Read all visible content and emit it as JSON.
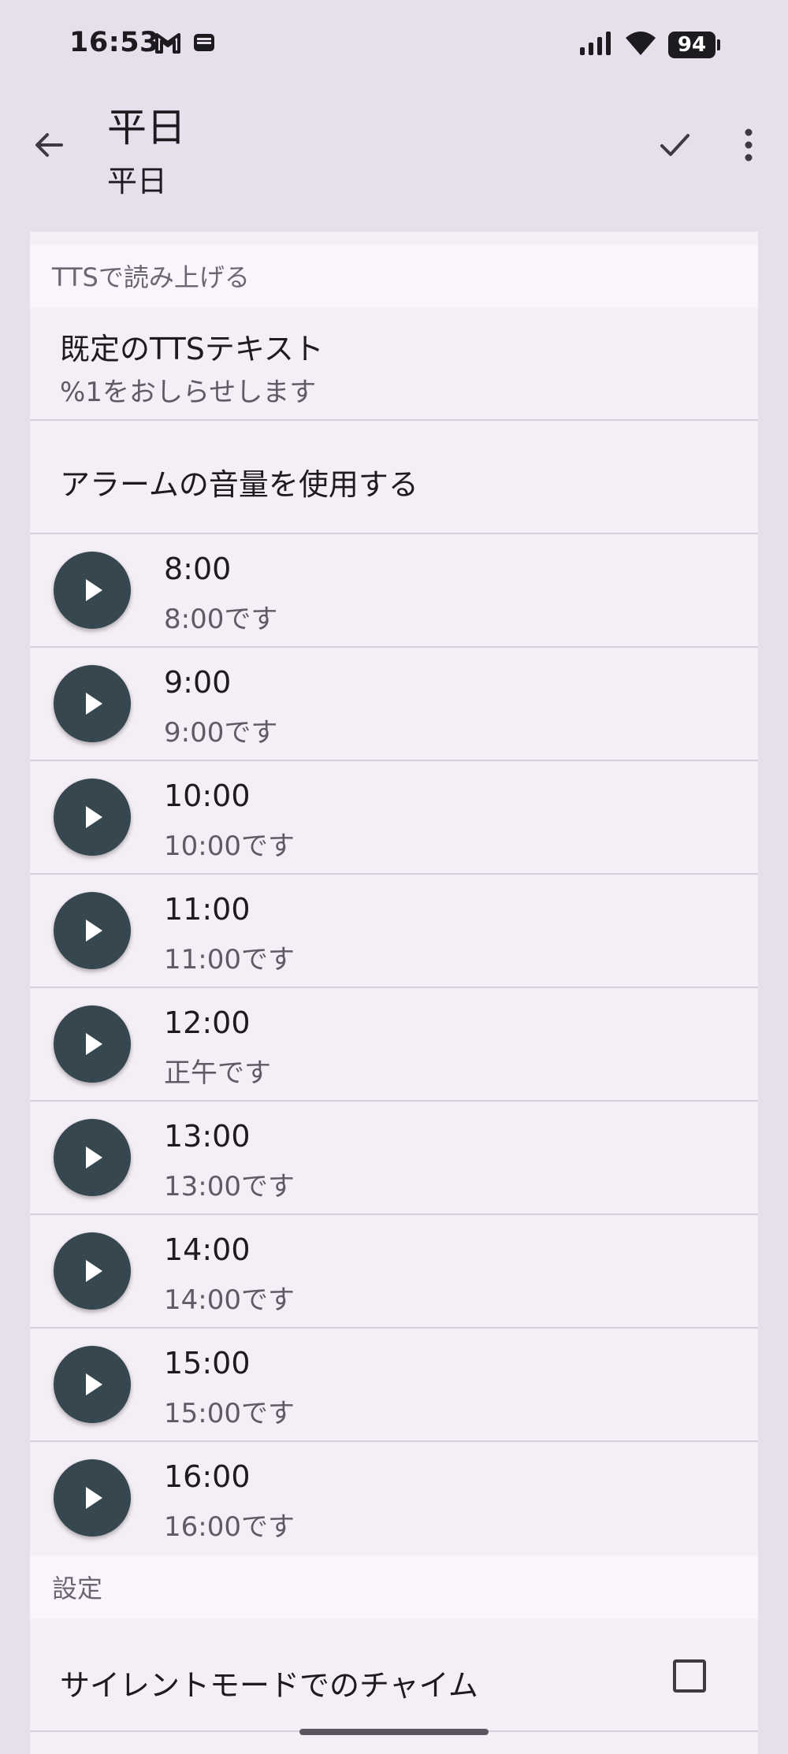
{
  "status_bar": {
    "time": "16:53",
    "battery": "94",
    "icons_left": [
      "gmail-icon",
      "wallet-icon"
    ],
    "icons_right": [
      "signal-icon",
      "wifi-icon",
      "battery-icon"
    ]
  },
  "app_bar": {
    "title": "平日",
    "subtitle": "平日",
    "back_icon": "arrow-back-icon",
    "check_icon": "check-icon",
    "more_icon": "more-vert-icon"
  },
  "tts_section": {
    "header": "TTSで読み上げる",
    "default_tts": {
      "primary": "既定のTTSテキスト",
      "secondary": "%1をおしらせします"
    },
    "alarm_volume": {
      "primary": "アラームの音量を使用する"
    },
    "times": [
      {
        "time": "8:00",
        "speech": "8:00です"
      },
      {
        "time": "9:00",
        "speech": "9:00です"
      },
      {
        "time": "10:00",
        "speech": "10:00です"
      },
      {
        "time": "11:00",
        "speech": "11:00です"
      },
      {
        "time": "12:00",
        "speech": "正午です"
      },
      {
        "time": "13:00",
        "speech": "13:00です"
      },
      {
        "time": "14:00",
        "speech": "14:00です"
      },
      {
        "time": "15:00",
        "speech": "15:00です"
      },
      {
        "time": "16:00",
        "speech": "16:00です"
      }
    ]
  },
  "settings_section": {
    "header": "設定",
    "silent_chime": {
      "label": "サイレントモードでのチャイム",
      "checked": false
    }
  },
  "colors": {
    "background": "#e7dfec",
    "card": "#f4eff6",
    "play_button": "#37474f"
  }
}
